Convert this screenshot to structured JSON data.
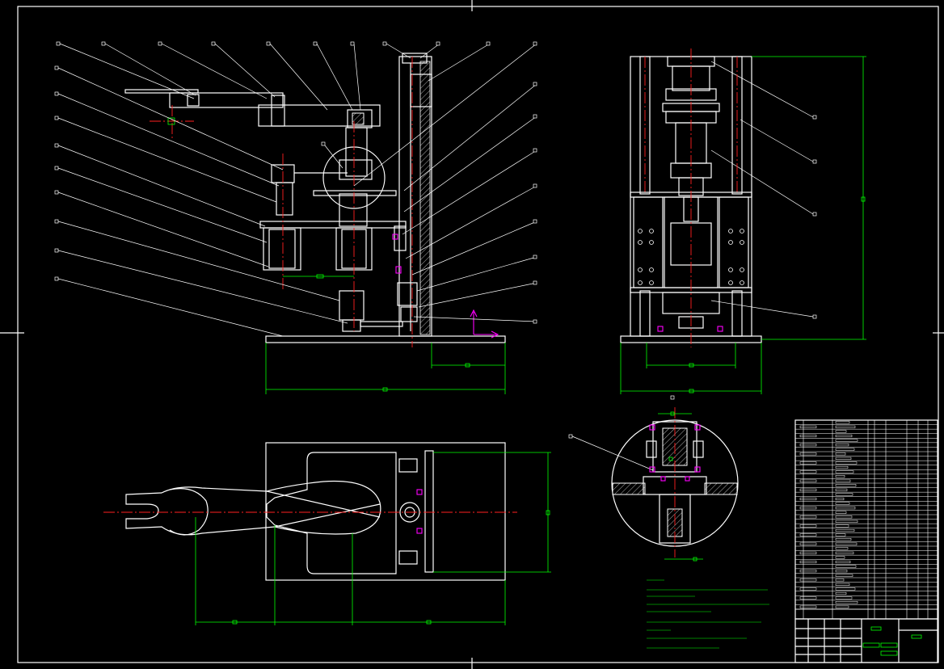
{
  "drawing": {
    "background": "#000000",
    "line_color": "#ffffff",
    "dimension_color": "#00ff00",
    "centerline_color": "#ff2020",
    "highlight_color": "#ff00ff"
  },
  "views": [
    "front-view",
    "side-view",
    "top-view",
    "detail-view"
  ],
  "parts_list": {
    "rows": 42
  }
}
